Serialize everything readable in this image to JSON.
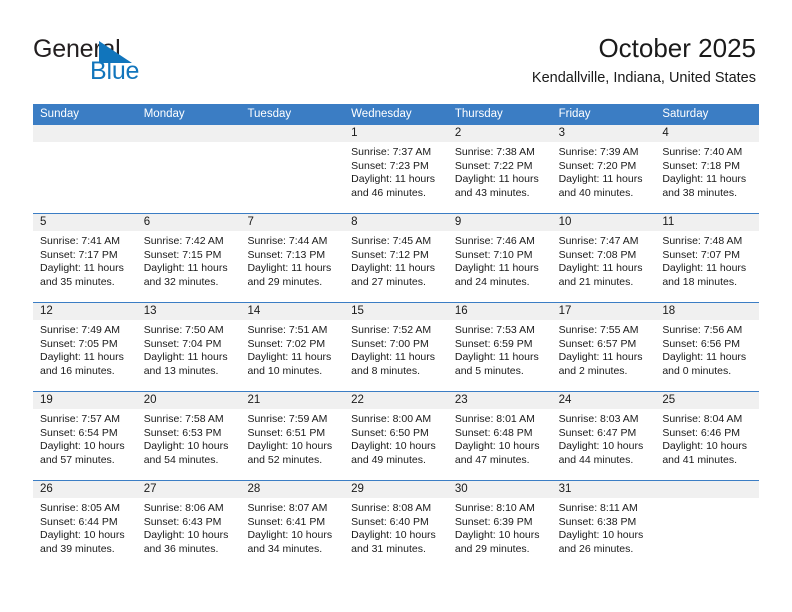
{
  "brand": {
    "name_top": "General",
    "name_bottom": "Blue",
    "triangle_icon": "blue-triangle-icon",
    "color_text": "#231f20",
    "color_blue": "#1175bc"
  },
  "header": {
    "title": "October 2025",
    "subtitle": "Kendallville, Indiana, United States"
  },
  "theme": {
    "header_blue": "#3b7dc4",
    "daynum_strip": "#f0f0f0",
    "cell_bg": "#ffffff",
    "text": "#1a1a1a"
  },
  "weekdays": [
    "Sunday",
    "Monday",
    "Tuesday",
    "Wednesday",
    "Thursday",
    "Friday",
    "Saturday"
  ],
  "weeks": [
    [
      {
        "day": "",
        "sunrise": "",
        "sunset": "",
        "daylight1": "",
        "daylight2": ""
      },
      {
        "day": "",
        "sunrise": "",
        "sunset": "",
        "daylight1": "",
        "daylight2": ""
      },
      {
        "day": "",
        "sunrise": "",
        "sunset": "",
        "daylight1": "",
        "daylight2": ""
      },
      {
        "day": "1",
        "sunrise": "Sunrise: 7:37 AM",
        "sunset": "Sunset: 7:23 PM",
        "daylight1": "Daylight: 11 hours",
        "daylight2": "and 46 minutes."
      },
      {
        "day": "2",
        "sunrise": "Sunrise: 7:38 AM",
        "sunset": "Sunset: 7:22 PM",
        "daylight1": "Daylight: 11 hours",
        "daylight2": "and 43 minutes."
      },
      {
        "day": "3",
        "sunrise": "Sunrise: 7:39 AM",
        "sunset": "Sunset: 7:20 PM",
        "daylight1": "Daylight: 11 hours",
        "daylight2": "and 40 minutes."
      },
      {
        "day": "4",
        "sunrise": "Sunrise: 7:40 AM",
        "sunset": "Sunset: 7:18 PM",
        "daylight1": "Daylight: 11 hours",
        "daylight2": "and 38 minutes."
      }
    ],
    [
      {
        "day": "5",
        "sunrise": "Sunrise: 7:41 AM",
        "sunset": "Sunset: 7:17 PM",
        "daylight1": "Daylight: 11 hours",
        "daylight2": "and 35 minutes."
      },
      {
        "day": "6",
        "sunrise": "Sunrise: 7:42 AM",
        "sunset": "Sunset: 7:15 PM",
        "daylight1": "Daylight: 11 hours",
        "daylight2": "and 32 minutes."
      },
      {
        "day": "7",
        "sunrise": "Sunrise: 7:44 AM",
        "sunset": "Sunset: 7:13 PM",
        "daylight1": "Daylight: 11 hours",
        "daylight2": "and 29 minutes."
      },
      {
        "day": "8",
        "sunrise": "Sunrise: 7:45 AM",
        "sunset": "Sunset: 7:12 PM",
        "daylight1": "Daylight: 11 hours",
        "daylight2": "and 27 minutes."
      },
      {
        "day": "9",
        "sunrise": "Sunrise: 7:46 AM",
        "sunset": "Sunset: 7:10 PM",
        "daylight1": "Daylight: 11 hours",
        "daylight2": "and 24 minutes."
      },
      {
        "day": "10",
        "sunrise": "Sunrise: 7:47 AM",
        "sunset": "Sunset: 7:08 PM",
        "daylight1": "Daylight: 11 hours",
        "daylight2": "and 21 minutes."
      },
      {
        "day": "11",
        "sunrise": "Sunrise: 7:48 AM",
        "sunset": "Sunset: 7:07 PM",
        "daylight1": "Daylight: 11 hours",
        "daylight2": "and 18 minutes."
      }
    ],
    [
      {
        "day": "12",
        "sunrise": "Sunrise: 7:49 AM",
        "sunset": "Sunset: 7:05 PM",
        "daylight1": "Daylight: 11 hours",
        "daylight2": "and 16 minutes."
      },
      {
        "day": "13",
        "sunrise": "Sunrise: 7:50 AM",
        "sunset": "Sunset: 7:04 PM",
        "daylight1": "Daylight: 11 hours",
        "daylight2": "and 13 minutes."
      },
      {
        "day": "14",
        "sunrise": "Sunrise: 7:51 AM",
        "sunset": "Sunset: 7:02 PM",
        "daylight1": "Daylight: 11 hours",
        "daylight2": "and 10 minutes."
      },
      {
        "day": "15",
        "sunrise": "Sunrise: 7:52 AM",
        "sunset": "Sunset: 7:00 PM",
        "daylight1": "Daylight: 11 hours",
        "daylight2": "and 8 minutes."
      },
      {
        "day": "16",
        "sunrise": "Sunrise: 7:53 AM",
        "sunset": "Sunset: 6:59 PM",
        "daylight1": "Daylight: 11 hours",
        "daylight2": "and 5 minutes."
      },
      {
        "day": "17",
        "sunrise": "Sunrise: 7:55 AM",
        "sunset": "Sunset: 6:57 PM",
        "daylight1": "Daylight: 11 hours",
        "daylight2": "and 2 minutes."
      },
      {
        "day": "18",
        "sunrise": "Sunrise: 7:56 AM",
        "sunset": "Sunset: 6:56 PM",
        "daylight1": "Daylight: 11 hours",
        "daylight2": "and 0 minutes."
      }
    ],
    [
      {
        "day": "19",
        "sunrise": "Sunrise: 7:57 AM",
        "sunset": "Sunset: 6:54 PM",
        "daylight1": "Daylight: 10 hours",
        "daylight2": "and 57 minutes."
      },
      {
        "day": "20",
        "sunrise": "Sunrise: 7:58 AM",
        "sunset": "Sunset: 6:53 PM",
        "daylight1": "Daylight: 10 hours",
        "daylight2": "and 54 minutes."
      },
      {
        "day": "21",
        "sunrise": "Sunrise: 7:59 AM",
        "sunset": "Sunset: 6:51 PM",
        "daylight1": "Daylight: 10 hours",
        "daylight2": "and 52 minutes."
      },
      {
        "day": "22",
        "sunrise": "Sunrise: 8:00 AM",
        "sunset": "Sunset: 6:50 PM",
        "daylight1": "Daylight: 10 hours",
        "daylight2": "and 49 minutes."
      },
      {
        "day": "23",
        "sunrise": "Sunrise: 8:01 AM",
        "sunset": "Sunset: 6:48 PM",
        "daylight1": "Daylight: 10 hours",
        "daylight2": "and 47 minutes."
      },
      {
        "day": "24",
        "sunrise": "Sunrise: 8:03 AM",
        "sunset": "Sunset: 6:47 PM",
        "daylight1": "Daylight: 10 hours",
        "daylight2": "and 44 minutes."
      },
      {
        "day": "25",
        "sunrise": "Sunrise: 8:04 AM",
        "sunset": "Sunset: 6:46 PM",
        "daylight1": "Daylight: 10 hours",
        "daylight2": "and 41 minutes."
      }
    ],
    [
      {
        "day": "26",
        "sunrise": "Sunrise: 8:05 AM",
        "sunset": "Sunset: 6:44 PM",
        "daylight1": "Daylight: 10 hours",
        "daylight2": "and 39 minutes."
      },
      {
        "day": "27",
        "sunrise": "Sunrise: 8:06 AM",
        "sunset": "Sunset: 6:43 PM",
        "daylight1": "Daylight: 10 hours",
        "daylight2": "and 36 minutes."
      },
      {
        "day": "28",
        "sunrise": "Sunrise: 8:07 AM",
        "sunset": "Sunset: 6:41 PM",
        "daylight1": "Daylight: 10 hours",
        "daylight2": "and 34 minutes."
      },
      {
        "day": "29",
        "sunrise": "Sunrise: 8:08 AM",
        "sunset": "Sunset: 6:40 PM",
        "daylight1": "Daylight: 10 hours",
        "daylight2": "and 31 minutes."
      },
      {
        "day": "30",
        "sunrise": "Sunrise: 8:10 AM",
        "sunset": "Sunset: 6:39 PM",
        "daylight1": "Daylight: 10 hours",
        "daylight2": "and 29 minutes."
      },
      {
        "day": "31",
        "sunrise": "Sunrise: 8:11 AM",
        "sunset": "Sunset: 6:38 PM",
        "daylight1": "Daylight: 10 hours",
        "daylight2": "and 26 minutes."
      },
      {
        "day": "",
        "sunrise": "",
        "sunset": "",
        "daylight1": "",
        "daylight2": ""
      }
    ]
  ]
}
